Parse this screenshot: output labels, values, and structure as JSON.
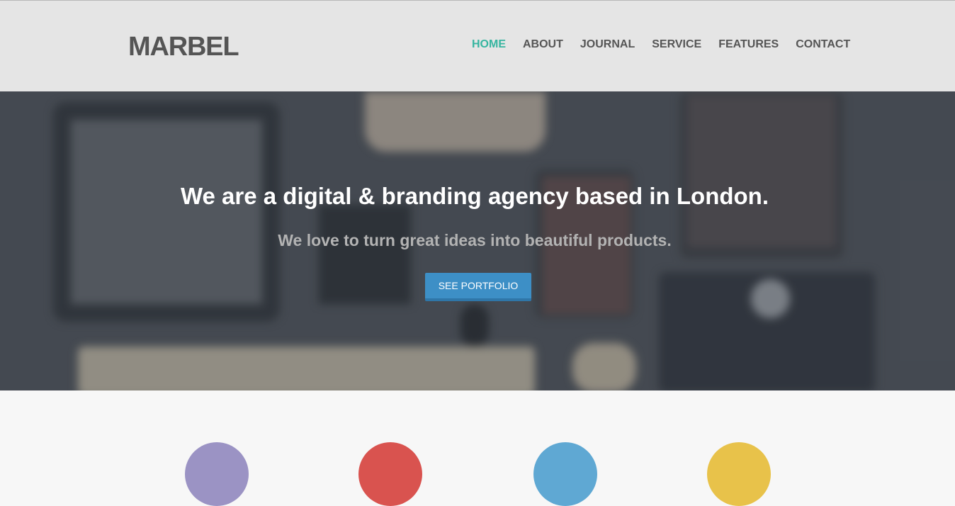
{
  "brand": {
    "logo": "MARBEL"
  },
  "nav": {
    "items": [
      {
        "label": "HOME",
        "active": true
      },
      {
        "label": "ABOUT",
        "active": false
      },
      {
        "label": "JOURNAL",
        "active": false
      },
      {
        "label": "SERVICE",
        "active": false
      },
      {
        "label": "FEATURES",
        "active": false
      },
      {
        "label": "CONTACT",
        "active": false
      }
    ]
  },
  "hero": {
    "title": "We are a digital & branding agency based in London.",
    "subtitle": "We love to turn great ideas into beautiful products.",
    "cta_label": "SEE PORTFOLIO"
  },
  "features": {
    "icons": [
      {
        "name": "feature-icon-1",
        "color": "#9b93c4"
      },
      {
        "name": "feature-icon-2",
        "color": "#d9534f"
      },
      {
        "name": "feature-icon-3",
        "color": "#5fa8d3"
      },
      {
        "name": "feature-icon-4",
        "color": "#e8c24a"
      }
    ]
  },
  "colors": {
    "accent": "#36b5a0",
    "button": "#3d8fc6",
    "header_bg": "#e5e5e5",
    "logo_text": "#555555"
  }
}
